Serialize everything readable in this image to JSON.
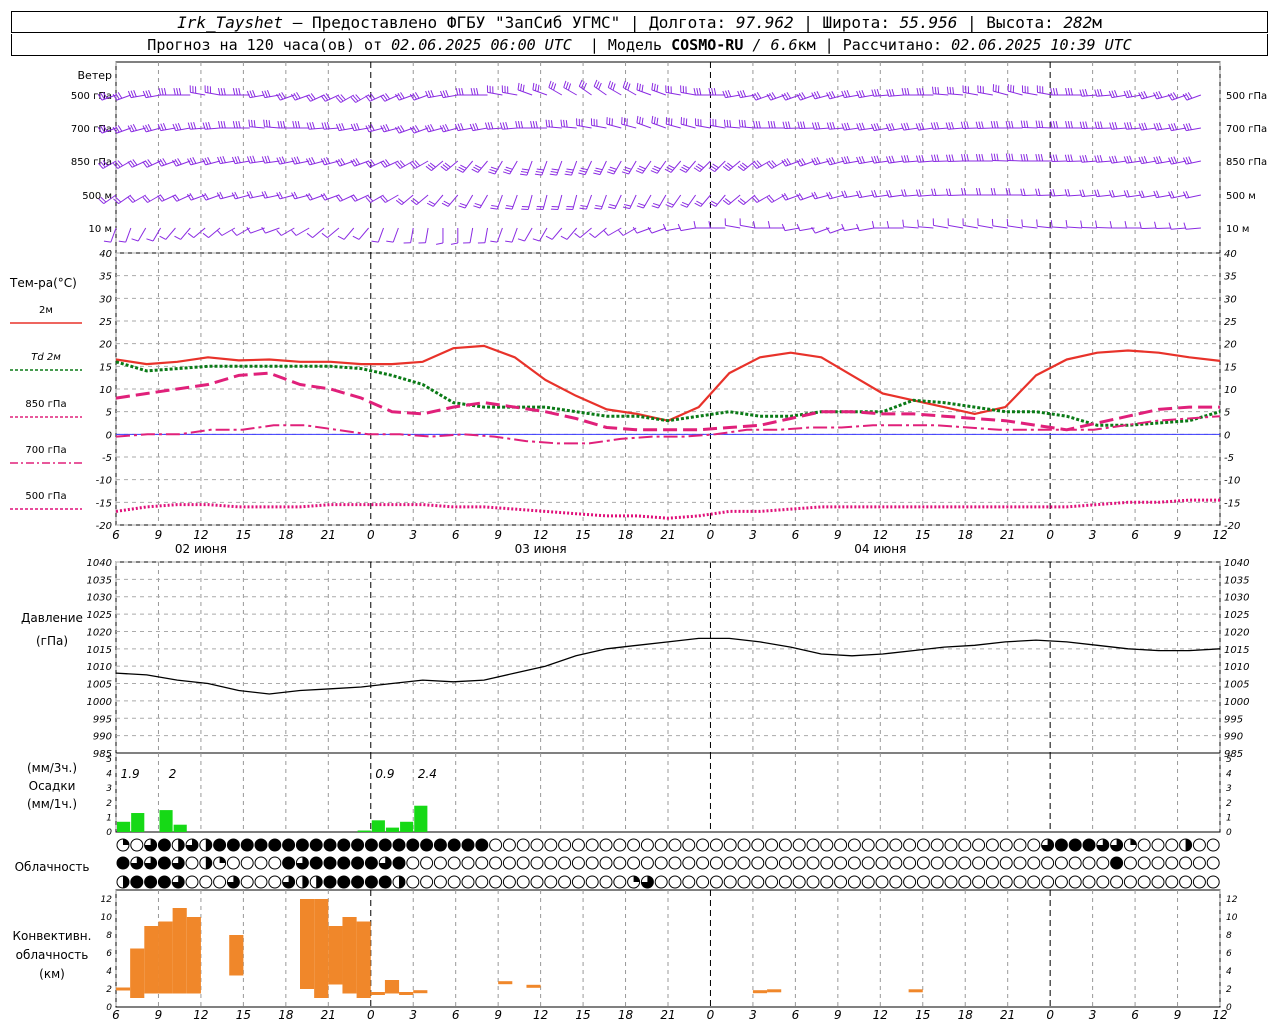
{
  "header": {
    "station": "Irk_Tayshet",
    "provider": "— Предоставлено ФГБУ \"ЗапСиб УГМС\" |",
    "lon_label": "Долгота:",
    "lon_value": "97.962",
    "lat_label": "| Широта:",
    "lat_value": "55.956",
    "alt_label": "| Высота:",
    "alt_value": "282",
    "alt_unit": "м",
    "forecast_label": "Прогноз на 120 часа(ов) от",
    "forecast_start": "02.06.2025 06:00 UTC",
    "model_label": "| Модель",
    "model_name": "COSMO-RU",
    "model_res": "/ 6.6",
    "model_unit": "км",
    "calc_label": "| Рассчитано:",
    "calc_time": "02.06.2025 10:39 UTC"
  },
  "labels": {
    "wind": "Ветер",
    "levels": [
      "500 гПа",
      "700 гПа",
      "850 гПа",
      "500 м",
      "10 м"
    ],
    "temp_title": "Тем-ра(°C)",
    "temp_legend": [
      "2м",
      "Td 2м",
      "850 гПа",
      "700 гПа",
      "500 гПа"
    ],
    "pressure_title": "Давление",
    "pressure_unit": "(гПа)",
    "precip_unit3": "(мм/3ч.)",
    "precip_title": "Осадки",
    "precip_unit1": "(мм/1ч.)",
    "cloud_title": "Облачность",
    "conv_title1": "Конвективн.",
    "conv_title2": "облачность",
    "conv_unit": "(км)",
    "days": [
      "02 июня",
      "03 июня",
      "04 июня"
    ]
  },
  "colors": {
    "t2m": "#e8322a",
    "td2m": "#0a7a16",
    "t850": "#e0207a",
    "t700": "#e0207a",
    "t500": "#e0107a",
    "wind": "#8a2be2",
    "pressure": "#000000",
    "precip": "#16d916",
    "conv": "#f0872a"
  },
  "chart_data": [
    {
      "type": "line",
      "title": "Тем-ра(°C)",
      "x_hours": [
        0,
        3,
        6,
        9,
        12,
        15,
        18,
        21,
        24,
        27,
        30,
        33,
        36,
        39,
        42,
        45,
        48,
        51,
        54,
        57,
        60,
        63,
        66,
        69,
        72,
        75,
        78
      ],
      "x_ticks": [
        "6",
        "9",
        "12",
        "15",
        "18",
        "21",
        "0",
        "3",
        "6",
        "9",
        "12",
        "15",
        "18",
        "21",
        "0",
        "3",
        "6",
        "9",
        "12",
        "15",
        "18",
        "21",
        "0",
        "3",
        "6",
        "9",
        "12"
      ],
      "ylim": [
        -20,
        40
      ],
      "yticks": [
        -20,
        -15,
        -10,
        -5,
        0,
        5,
        10,
        15,
        20,
        25,
        30,
        35,
        40
      ],
      "series": [
        {
          "name": "2м",
          "key": "t2m",
          "dash": "",
          "width": 2.2,
          "values": [
            16.5,
            15.5,
            16,
            17,
            16.3,
            16.5,
            16,
            16,
            15.5,
            15.5,
            16,
            19,
            19.5,
            17,
            12,
            8.5,
            5.5,
            4.5,
            3,
            6,
            13.5,
            17,
            18,
            17,
            13,
            9,
            7.5,
            6,
            4.5,
            6,
            13,
            16.5,
            18,
            18.5,
            18,
            17,
            16.2
          ]
        },
        {
          "name": "Td 2м",
          "key": "td2m",
          "dash": "3,2",
          "width": 3,
          "values": [
            16,
            14,
            14.5,
            15,
            15,
            15,
            15,
            15,
            14.5,
            13,
            11,
            7,
            6,
            6,
            6,
            5,
            4,
            4,
            3,
            4,
            5,
            4,
            4,
            5,
            5,
            5,
            7.5,
            7,
            6,
            5,
            5,
            4,
            2,
            2,
            2.5,
            3,
            5
          ]
        },
        {
          "name": "850 гПа",
          "key": "t850",
          "dash": "14,6",
          "width": 3,
          "values": [
            8,
            9,
            10,
            11,
            13,
            13.5,
            11,
            10,
            8,
            5,
            4.5,
            6,
            7,
            6,
            5,
            3.5,
            1.5,
            1,
            1,
            1,
            1.5,
            2,
            3.5,
            5,
            5,
            4.5,
            4.5,
            4,
            3.5,
            3,
            2,
            1,
            2.5,
            4,
            5.5,
            6,
            6
          ]
        },
        {
          "name": "700 гПа",
          "key": "t700",
          "dash": "14,4,3,4",
          "width": 2,
          "values": [
            -0.5,
            0,
            0,
            1,
            1,
            2,
            2,
            1,
            0,
            0,
            -0.5,
            0,
            -0.5,
            -1.5,
            -2,
            -2,
            -1,
            -0.5,
            -0.5,
            0,
            1,
            1,
            1.5,
            1.5,
            2,
            2,
            2,
            1.5,
            1,
            1,
            1,
            1,
            2,
            3,
            3.5,
            4
          ]
        },
        {
          "name": "500 гПа",
          "key": "t500",
          "dash": "2,2",
          "width": 3,
          "values": [
            -17,
            -16,
            -15.5,
            -15.5,
            -16,
            -16,
            -16,
            -15.5,
            -15.5,
            -15.5,
            -15.5,
            -16,
            -16,
            -16.5,
            -17,
            -17.5,
            -18,
            -18,
            -18.5,
            -18,
            -17,
            -17,
            -16.5,
            -16,
            -16,
            -16,
            -16,
            -16,
            -16,
            -16,
            -16,
            -16,
            -15.5,
            -15,
            -15,
            -14.5,
            -14.5
          ]
        }
      ]
    },
    {
      "type": "line",
      "title": "Давление",
      "ylabel": "(гПа)",
      "ylim": [
        985,
        1040
      ],
      "yticks": [
        985,
        990,
        995,
        1000,
        1005,
        1010,
        1015,
        1020,
        1025,
        1030,
        1035,
        1040
      ],
      "series": [
        {
          "name": "Давление",
          "key": "pressure",
          "values": [
            1008,
            1007.5,
            1006,
            1005,
            1003,
            1002,
            1003,
            1003.5,
            1004,
            1005,
            1006,
            1005.5,
            1006,
            1008,
            1010,
            1013,
            1015,
            1016,
            1017,
            1018,
            1018,
            1017,
            1015.5,
            1013.5,
            1013,
            1013.5,
            1014.5,
            1015.5,
            1016,
            1017,
            1017.5,
            1017,
            1016,
            1015,
            1014.5,
            1014.5,
            1015
          ]
        }
      ]
    },
    {
      "type": "bar",
      "title": "Осадки",
      "ylabel": "(мм/1ч.)",
      "ylim": [
        0,
        5
      ],
      "bar_hours": [
        0,
        1,
        2,
        3,
        4,
        5,
        6,
        7,
        8,
        9,
        10,
        11,
        12,
        13,
        14,
        15,
        16,
        17,
        18,
        19,
        20,
        21,
        22,
        23,
        24
      ],
      "values": [
        0.7,
        1.3,
        0,
        1.5,
        0.5,
        0,
        0,
        0,
        0,
        0,
        0,
        0,
        0,
        0,
        0,
        0,
        0,
        0.1,
        0.8,
        0.3,
        0.7,
        1.8,
        0,
        0,
        0
      ],
      "totals_3h": [
        {
          "hour": 1,
          "text": "1.9"
        },
        {
          "hour": 4,
          "text": "2"
        },
        {
          "hour": 19,
          "text": "0.9"
        },
        {
          "hour": 22,
          "text": "2.4"
        }
      ]
    },
    {
      "type": "table",
      "title": "Облачность",
      "note": "Cloud cover per hour for three layers, value = oktas/8 fraction",
      "rows": [
        [
          0.25,
          0,
          0.75,
          1,
          0.5,
          0.75,
          0.5,
          1,
          1,
          1,
          1,
          1,
          1,
          1,
          1,
          1,
          1,
          1,
          1,
          1,
          1,
          1,
          1,
          1,
          1,
          1,
          1,
          0,
          0,
          0,
          0,
          0,
          0,
          0,
          0,
          0,
          0,
          0,
          0,
          0,
          0,
          0,
          0,
          0,
          0,
          0,
          0,
          0,
          0,
          0,
          0,
          0,
          0,
          0,
          0,
          0,
          0,
          0,
          0,
          0,
          0,
          0,
          0,
          0,
          0,
          0,
          0,
          0.75,
          1,
          1,
          1,
          0.75,
          0.75,
          0.25,
          0,
          0,
          0,
          0.5,
          0,
          0,
          0.25,
          0,
          0,
          0.25,
          0,
          0,
          0,
          0,
          0,
          0,
          0,
          0,
          1,
          0.75,
          0.5,
          1,
          1,
          0.5,
          0.25,
          0,
          0,
          0,
          0,
          0,
          0,
          0,
          0,
          0,
          0,
          0,
          0,
          0,
          0,
          0,
          0,
          0,
          0,
          0,
          0,
          0,
          0
        ],
        [
          1,
          0.75,
          0.75,
          1,
          0.75,
          0,
          0.5,
          0.25,
          0,
          0,
          0,
          0,
          1,
          0.75,
          1,
          1,
          1,
          1,
          1,
          0.75,
          1,
          0,
          0,
          0,
          0,
          0,
          0,
          0,
          0,
          0,
          0,
          0,
          0,
          0,
          0,
          0,
          0,
          0,
          0,
          0,
          0,
          0,
          0,
          0,
          0,
          0,
          0,
          0,
          0,
          0,
          0,
          0,
          0,
          0,
          0,
          0,
          0,
          0,
          0,
          0,
          0,
          0,
          0,
          0,
          0,
          0,
          0,
          0,
          0,
          0,
          0,
          0,
          1,
          0,
          0,
          0,
          0,
          0,
          0,
          0,
          0,
          0,
          0,
          0,
          0,
          0,
          0,
          0,
          0,
          0,
          0,
          0,
          0,
          0.25,
          0,
          0,
          0,
          0,
          0,
          0,
          0,
          0,
          0,
          0,
          0,
          0,
          0,
          0,
          0,
          0,
          0,
          0,
          0,
          0,
          0,
          0,
          0,
          0,
          0,
          0,
          0,
          0,
          0
        ],
        [
          0.5,
          1,
          1,
          1,
          0.75,
          0,
          0,
          0,
          0.75,
          0,
          0,
          0,
          0.75,
          0.5,
          0.5,
          1,
          1,
          1,
          1,
          1,
          0.5,
          0,
          0,
          0,
          0,
          0,
          0,
          0,
          0,
          0,
          0,
          0,
          0,
          0,
          0,
          0,
          0,
          0.25,
          0.75,
          0,
          0,
          0,
          0,
          0,
          0,
          0,
          0,
          0,
          0,
          0,
          0,
          0,
          0,
          0,
          0,
          0,
          0,
          0,
          0,
          0,
          0,
          0,
          0,
          0,
          0,
          0,
          0,
          0,
          0,
          0,
          0,
          0,
          0,
          0,
          0,
          0,
          0,
          0,
          0,
          0,
          0,
          0,
          0,
          0,
          0,
          0,
          0,
          0,
          0,
          0,
          0,
          0,
          0,
          0,
          0,
          0,
          0,
          0,
          0,
          0,
          0,
          0,
          0,
          0,
          0,
          0,
          0,
          0,
          0,
          0,
          0,
          0,
          0,
          0,
          0,
          0.25,
          0,
          0,
          0,
          0,
          0,
          0,
          0,
          0,
          0
        ]
      ]
    },
    {
      "type": "bar",
      "title": "Конвективн. облачность",
      "ylabel": "(км)",
      "ylim": [
        0,
        13
      ],
      "yticks": [
        0,
        2,
        4,
        6,
        8,
        10,
        12
      ],
      "segments": [
        {
          "h": 0,
          "lo": 2,
          "hi": 2
        },
        {
          "h": 1,
          "lo": 1,
          "hi": 6.5
        },
        {
          "h": 2,
          "lo": 1.5,
          "hi": 9
        },
        {
          "h": 3,
          "lo": 1.5,
          "hi": 9.5
        },
        {
          "h": 4,
          "lo": 1.5,
          "hi": 11
        },
        {
          "h": 5,
          "lo": 1.5,
          "hi": 10
        },
        {
          "h": 8,
          "lo": 3.5,
          "hi": 8
        },
        {
          "h": 13,
          "lo": 2,
          "hi": 12
        },
        {
          "h": 14,
          "lo": 1,
          "hi": 12
        },
        {
          "h": 15,
          "lo": 2.5,
          "hi": 9
        },
        {
          "h": 16,
          "lo": 1.5,
          "hi": 10
        },
        {
          "h": 17,
          "lo": 1,
          "hi": 9.5
        },
        {
          "h": 18,
          "lo": 1.5,
          "hi": 1.5
        },
        {
          "h": 19,
          "lo": 1.5,
          "hi": 3
        },
        {
          "h": 20,
          "lo": 1.5,
          "hi": 1.5
        },
        {
          "h": 21,
          "lo": 1.7,
          "hi": 1.7
        },
        {
          "h": 27,
          "lo": 2.7,
          "hi": 2.7
        },
        {
          "h": 29,
          "lo": 2.3,
          "hi": 2.3
        },
        {
          "h": 45,
          "lo": 1.7,
          "hi": 1.7
        },
        {
          "h": 46,
          "lo": 1.8,
          "hi": 1.8
        },
        {
          "h": 56,
          "lo": 1.8,
          "hi": 1.8
        }
      ]
    }
  ]
}
